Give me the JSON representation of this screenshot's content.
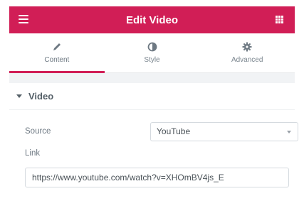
{
  "header": {
    "title": "Edit Video",
    "menu_icon": "hamburger-icon",
    "apps_icon": "grid-icon",
    "background": "#d11e56"
  },
  "tabs": [
    {
      "label": "Content",
      "icon": "pencil-icon",
      "active": true
    },
    {
      "label": "Style",
      "icon": "half-circle-icon",
      "active": false
    },
    {
      "label": "Advanced",
      "icon": "gear-icon",
      "active": false
    }
  ],
  "section": {
    "title": "Video",
    "icon": "caret-down-icon"
  },
  "fields": {
    "source_label": "Source",
    "source_value": "YouTube",
    "link_label": "Link",
    "link_value": "https://www.youtube.com/watch?v=XHOmBV4js_E"
  }
}
